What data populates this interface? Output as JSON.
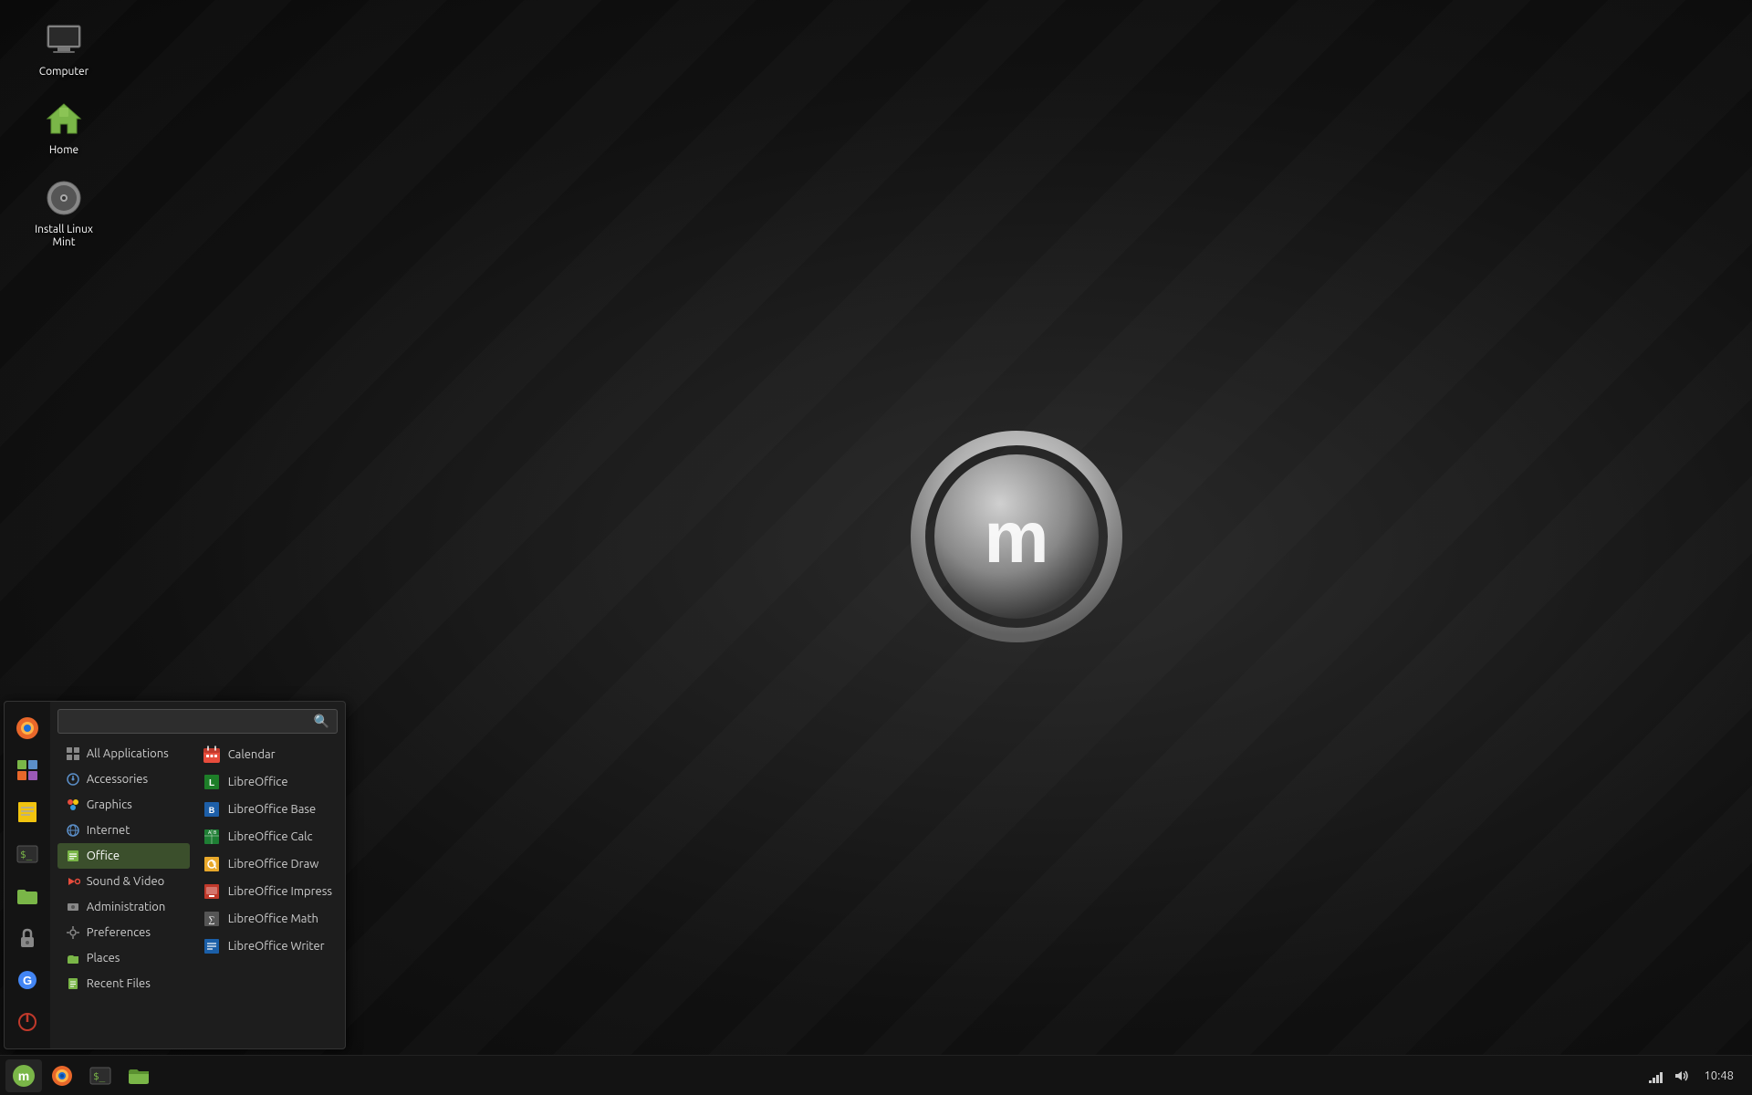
{
  "desktop": {
    "icons": [
      {
        "id": "computer",
        "label": "Computer",
        "type": "computer"
      },
      {
        "id": "home",
        "label": "Home",
        "type": "folder-home"
      },
      {
        "id": "install",
        "label": "Install Linux Mint",
        "type": "disc"
      }
    ]
  },
  "start_menu": {
    "search_placeholder": "",
    "categories": [
      {
        "id": "all",
        "label": "All Applications",
        "icon": "grid",
        "active": false
      },
      {
        "id": "accessories",
        "label": "Accessories",
        "icon": "accessories",
        "active": false
      },
      {
        "id": "graphics",
        "label": "Graphics",
        "icon": "graphics",
        "active": false
      },
      {
        "id": "internet",
        "label": "Internet",
        "icon": "internet",
        "active": false
      },
      {
        "id": "office",
        "label": "Office",
        "icon": "office",
        "active": true
      },
      {
        "id": "sound-video",
        "label": "Sound & Video",
        "icon": "media",
        "active": false
      },
      {
        "id": "administration",
        "label": "Administration",
        "icon": "admin",
        "active": false
      },
      {
        "id": "preferences",
        "label": "Preferences",
        "icon": "prefs",
        "active": false
      },
      {
        "id": "places",
        "label": "Places",
        "icon": "places",
        "active": false
      },
      {
        "id": "recent",
        "label": "Recent Files",
        "icon": "recent",
        "active": false
      }
    ],
    "apps": [
      {
        "id": "calendar",
        "label": "Calendar",
        "icon": "calendar",
        "color": "#e74c3c"
      },
      {
        "id": "libreoffice",
        "label": "LibreOffice",
        "icon": "libreoffice",
        "color": "#1d7e28"
      },
      {
        "id": "libreoffice-base",
        "label": "LibreOffice Base",
        "icon": "lo-base",
        "color": "#1d5fa8"
      },
      {
        "id": "libreoffice-calc",
        "label": "LibreOffice Calc",
        "icon": "lo-calc",
        "color": "#1e7e34"
      },
      {
        "id": "libreoffice-draw",
        "label": "LibreOffice Draw",
        "icon": "lo-draw",
        "color": "#e8a82a"
      },
      {
        "id": "libreoffice-impress",
        "label": "LibreOffice Impress",
        "icon": "lo-impress",
        "color": "#c0392b"
      },
      {
        "id": "libreoffice-math",
        "label": "LibreOffice Math",
        "icon": "lo-math",
        "color": "#555"
      },
      {
        "id": "libreoffice-writer",
        "label": "LibreOffice Writer",
        "icon": "lo-writer",
        "color": "#1b5fa8"
      }
    ]
  },
  "taskbar": {
    "items": [
      {
        "id": "mint-menu",
        "type": "mint"
      },
      {
        "id": "firefox",
        "type": "firefox"
      },
      {
        "id": "terminal",
        "type": "terminal"
      },
      {
        "id": "files",
        "type": "files"
      }
    ],
    "clock": "10:48",
    "tray_icons": [
      "network",
      "volume"
    ]
  }
}
